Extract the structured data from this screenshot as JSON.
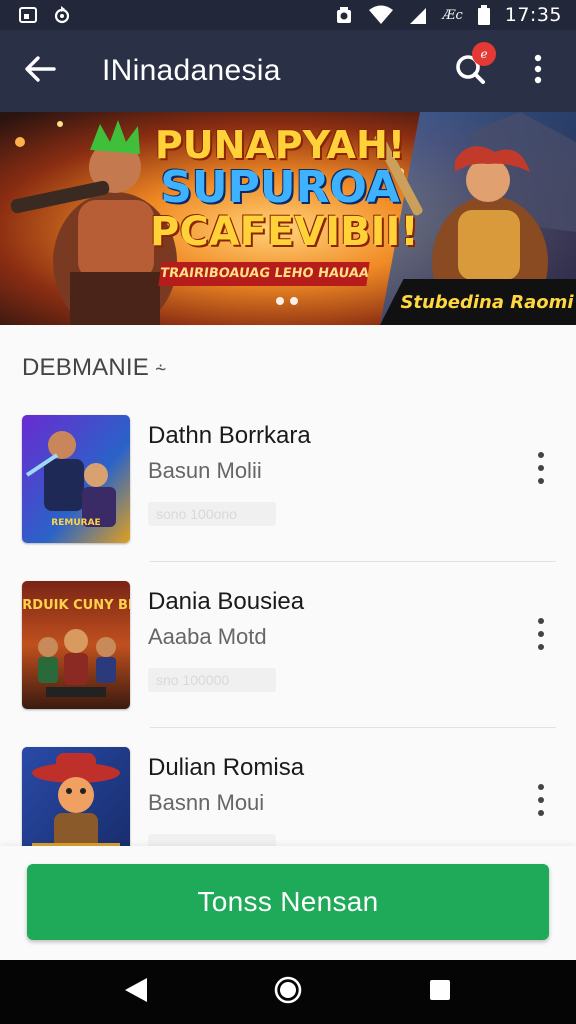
{
  "status_bar": {
    "time": "17:35",
    "carrier_label": "Æc",
    "icons": [
      "gallery-icon",
      "sync-icon",
      "camera-icon",
      "wifi-icon",
      "signal-icon",
      "battery-icon"
    ]
  },
  "app_bar": {
    "title": "INinadanesia",
    "notification_badge": "e",
    "icons": [
      "back-arrow-icon",
      "search-icon",
      "more-vertical-icon"
    ]
  },
  "banner": {
    "headline_line1": "PUNAPYAH!",
    "headline_line2": "SUPUROA",
    "headline_line3": "PCAFEVIBII!",
    "tagline": "TRAIRIBOAUAG LEHO HAUAA",
    "cta": "Stubedina Raomi",
    "dots": 2
  },
  "section": {
    "title": "DEBMANIE",
    "info_glyph": "⸞"
  },
  "games": [
    {
      "title": "Dathn Borrkara",
      "subtitle": "Basun Molii",
      "chip": "sono 100ono",
      "thumb_caption": "REMURAE"
    },
    {
      "title": "Dania Bousiea",
      "subtitle": "Aaaba Motd",
      "chip": "sno 100000",
      "thumb_caption": "MORDUIK CUNY BIAN"
    },
    {
      "title": "Dulian Romisa",
      "subtitle": "Basnn Moui",
      "chip": "",
      "thumb_caption": ""
    }
  ],
  "primary_button": {
    "label": "Tonss Nensan"
  },
  "colors": {
    "status_bar_bg": "#22283a",
    "app_bar_bg": "#2a3147",
    "accent_green": "#1faa59",
    "badge_red": "#e53935"
  }
}
